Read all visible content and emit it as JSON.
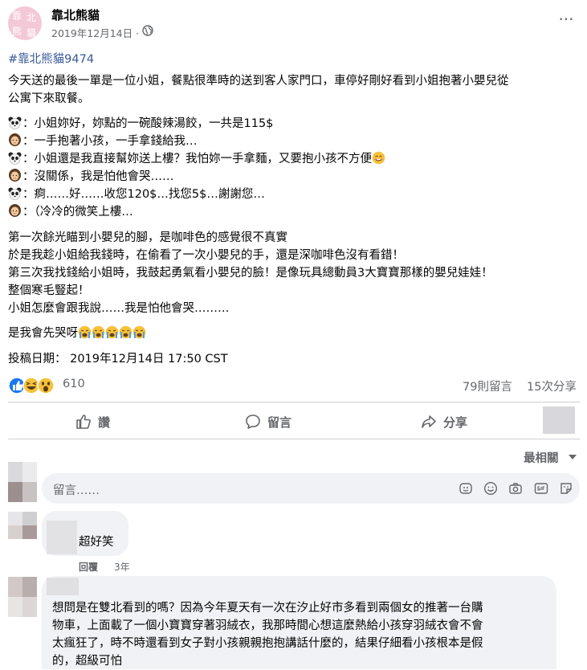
{
  "post": {
    "page_name": "靠北熊貓",
    "avatar_text": [
      "靠",
      "北",
      "熊",
      "貓"
    ],
    "date": "2019年12月14日 ·",
    "hashtag": "#靠北熊貓9474",
    "paragraph1": [
      "今天送的最後一單是一位小姐，餐點很準時的送到客人家門口，車停好剛好看到小姐抱著小嬰兒從",
      "公寓下來取餐。"
    ],
    "dialogue": [
      {
        "speaker": "panda",
        "text": "：小姐妳好，妳點的一碗酸辣湯餃，一共是115$"
      },
      {
        "speaker": "woman",
        "text": "：一手抱著小孩，一手拿錢給我…"
      },
      {
        "speaker": "panda",
        "text": "：小姐還是我直接幫妳送上樓？我怕妳一手拿麵，又要抱小孩不方便"
      },
      {
        "speaker": "woman",
        "text": "：沒關係，我是怕他會哭……"
      },
      {
        "speaker": "panda",
        "text": "：痾……好……收您120$…找您5$…謝謝您…"
      },
      {
        "speaker": "woman",
        "text": "：（冷冷的微笑上樓…"
      }
    ],
    "paragraph2": [
      "第一次餘光瞄到小嬰兒的腳，是咖啡色的感覺很不真實",
      "於是我趁小姐給我錢時，在偷看了一次小嬰兒的手，還是深咖啡色沒有看錯！",
      "第三次我找錢給小姐時，我鼓起勇氣看小嬰兒的臉！是像玩具總動員3大寶寶那樣的嬰兒娃娃！",
      "整個寒毛豎起！",
      "小姐怎麼會跟我說……我是怕他會哭………"
    ],
    "closing": "是我會先哭呀",
    "submit_date": "投稿日期：  2019年12月14日 17:50 CST"
  },
  "stats": {
    "reactions": "610",
    "comments": "79則留言",
    "shares": "15次分享"
  },
  "actions": {
    "like": "讚",
    "comment": "留言",
    "share": "分享"
  },
  "sort": {
    "label": "最相關"
  },
  "composer": {
    "placeholder": "留言……"
  },
  "comments": [
    {
      "text": "超好笑",
      "reply_label": "回覆",
      "time": "3年"
    },
    {
      "lines": [
        "想問是在雙北看到的嗎？因為今年夏天有一次在汐止好市多看到兩個女的推著一台購",
        "物車，上面載了一個小寶寶穿著羽絨衣，我那時間心想這麼熱給小孩穿羽絨衣會不會",
        "太瘋狂了，時不時還看到女子對小孩親親抱抱講話什麼的，結果仔細看小孩根本是假",
        "的，超級可怕"
      ]
    }
  ],
  "colors": {
    "link": "#385898",
    "secondary": "#65676b",
    "bubble": "#f0f2f5",
    "like_blue": "#1877f2"
  }
}
